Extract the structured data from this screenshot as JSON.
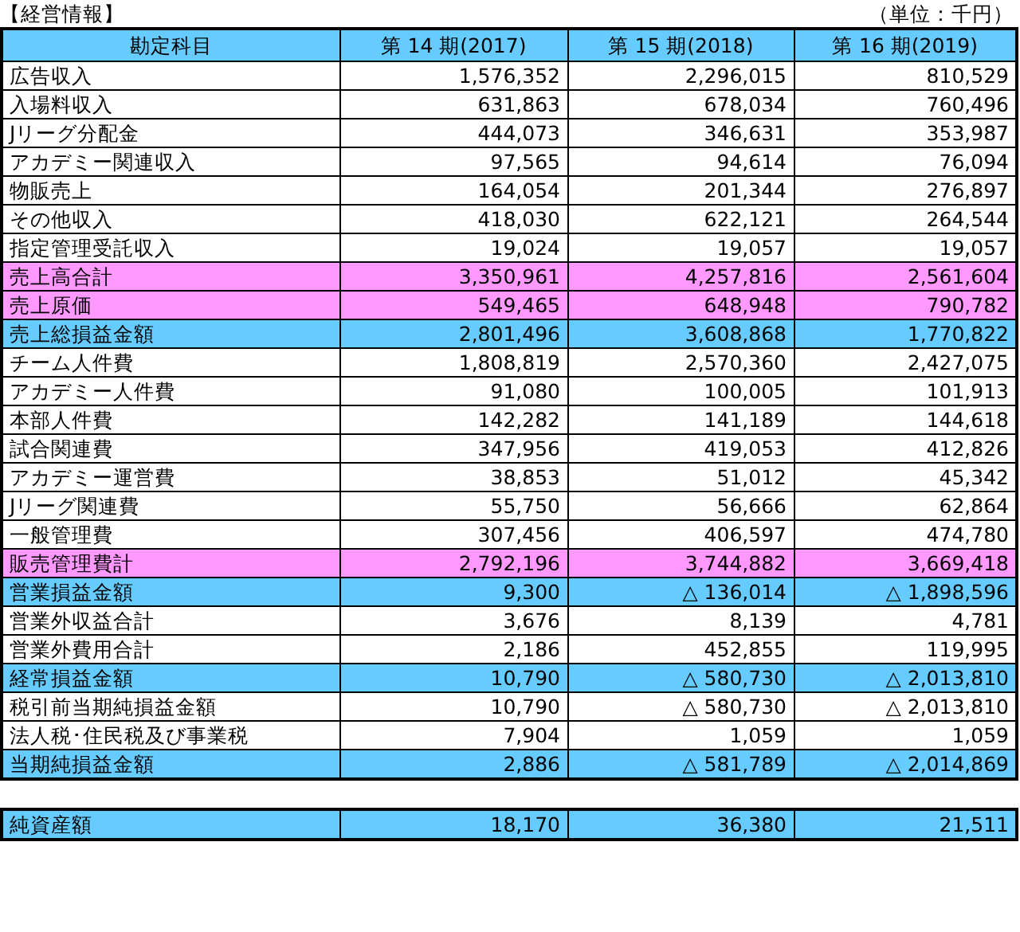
{
  "title": "【経営情報】",
  "unit": "（単位：千円）",
  "columns": [
    "勘定科目",
    "第 14 期(2017)",
    "第 15 期(2018)",
    "第 16 期(2019)"
  ],
  "rows": [
    {
      "kind": "plain",
      "label": "広告収入",
      "values": [
        "1,576,352",
        "2,296,015",
        "810,529"
      ]
    },
    {
      "kind": "plain",
      "label": "入場料収入",
      "values": [
        "631,863",
        "678,034",
        "760,496"
      ]
    },
    {
      "kind": "plain",
      "label": "Jリーグ分配金",
      "values": [
        "444,073",
        "346,631",
        "353,987"
      ]
    },
    {
      "kind": "plain",
      "label": "アカデミー関連収入",
      "values": [
        "97,565",
        "94,614",
        "76,094"
      ]
    },
    {
      "kind": "plain",
      "label": "物販売上",
      "values": [
        "164,054",
        "201,344",
        "276,897"
      ]
    },
    {
      "kind": "plain",
      "label": "その他収入",
      "values": [
        "418,030",
        "622,121",
        "264,544"
      ]
    },
    {
      "kind": "plain",
      "label": "指定管理受託収入",
      "values": [
        "19,024",
        "19,057",
        "19,057"
      ]
    },
    {
      "kind": "total",
      "label": "売上高合計",
      "values": [
        "3,350,961",
        "4,257,816",
        "2,561,604"
      ]
    },
    {
      "kind": "total",
      "label": "売上原価",
      "values": [
        "549,465",
        "648,948",
        "790,782"
      ]
    },
    {
      "kind": "profit",
      "label": "売上総損益金額",
      "values": [
        "2,801,496",
        "3,608,868",
        "1,770,822"
      ]
    },
    {
      "kind": "plain",
      "label": "チーム人件費",
      "values": [
        "1,808,819",
        "2,570,360",
        "2,427,075"
      ]
    },
    {
      "kind": "plain",
      "label": "アカデミー人件費",
      "values": [
        "91,080",
        "100,005",
        "101,913"
      ]
    },
    {
      "kind": "plain",
      "label": "本部人件費",
      "values": [
        "142,282",
        "141,189",
        "144,618"
      ]
    },
    {
      "kind": "plain",
      "label": "試合関連費",
      "values": [
        "347,956",
        "419,053",
        "412,826"
      ]
    },
    {
      "kind": "plain",
      "label": "アカデミー運営費",
      "values": [
        "38,853",
        "51,012",
        "45,342"
      ]
    },
    {
      "kind": "plain",
      "label": "Jリーグ関連費",
      "values": [
        "55,750",
        "56,666",
        "62,864"
      ]
    },
    {
      "kind": "plain",
      "label": "一般管理費",
      "values": [
        "307,456",
        "406,597",
        "474,780"
      ]
    },
    {
      "kind": "total",
      "label": "販売管理費計",
      "values": [
        "2,792,196",
        "3,744,882",
        "3,669,418"
      ]
    },
    {
      "kind": "profit",
      "label": "営業損益金額",
      "values": [
        "9,300",
        "△ 136,014",
        "△ 1,898,596"
      ]
    },
    {
      "kind": "plain",
      "label": "営業外収益合計",
      "values": [
        "3,676",
        "8,139",
        "4,781"
      ]
    },
    {
      "kind": "plain",
      "label": "営業外費用合計",
      "values": [
        "2,186",
        "452,855",
        "119,995"
      ]
    },
    {
      "kind": "profit",
      "label": "経常損益金額",
      "values": [
        "10,790",
        "△ 580,730",
        "△ 2,013,810"
      ]
    },
    {
      "kind": "plain",
      "label": "税引前当期純損益金額",
      "values": [
        "10,790",
        "△ 580,730",
        "△ 2,013,810"
      ]
    },
    {
      "kind": "plain",
      "label": "法人税･住民税及び事業税",
      "values": [
        "7,904",
        "1,059",
        "1,059"
      ]
    },
    {
      "kind": "profit",
      "label": "当期純損益金額",
      "values": [
        "2,886",
        "△ 581,789",
        "△ 2,014,869"
      ]
    }
  ],
  "net_assets": {
    "kind": "profit",
    "label": "純資産額",
    "values": [
      "18,170",
      "36,380",
      "21,511"
    ]
  }
}
